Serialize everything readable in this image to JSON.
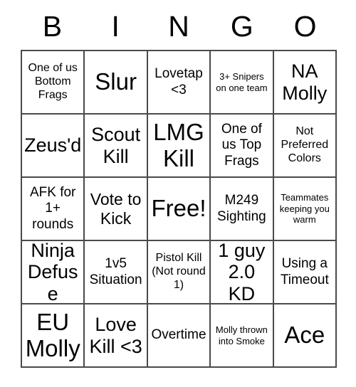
{
  "card": {
    "title": "BINGO",
    "header_letters": [
      "B",
      "I",
      "N",
      "G",
      "O"
    ],
    "grid_size": 5,
    "colors": {
      "background": "#ffffff",
      "grid_line": "#4a4a4a",
      "text": "#000000"
    },
    "cells": [
      {
        "text": "One of us Bottom Frags",
        "size": "sm"
      },
      {
        "text": "Slur",
        "size": "xxl"
      },
      {
        "text": "Lovetap <3",
        "size": "md"
      },
      {
        "text": "3+ Snipers on one team",
        "size": "xs"
      },
      {
        "text": "NA Molly",
        "size": "xl"
      },
      {
        "text": "Zeus'd",
        "size": "xl"
      },
      {
        "text": "Scout Kill",
        "size": "xl"
      },
      {
        "text": "LMG Kill",
        "size": "xxl"
      },
      {
        "text": "One of us Top Frags",
        "size": "md"
      },
      {
        "text": "Not Preferred Colors",
        "size": "sm"
      },
      {
        "text": "AFK for 1+ rounds",
        "size": "md"
      },
      {
        "text": "Vote to Kick",
        "size": "lg"
      },
      {
        "text": "Free!",
        "size": "xxl"
      },
      {
        "text": "M249 Sighting",
        "size": "md"
      },
      {
        "text": "Teammates keeping you warm",
        "size": "xs"
      },
      {
        "text": "Ninja Defuse",
        "size": "xl"
      },
      {
        "text": "1v5 Situation",
        "size": "md"
      },
      {
        "text": "Pistol Kill (Not round 1)",
        "size": "sm"
      },
      {
        "text": "1 guy 2.0 KD",
        "size": "xl"
      },
      {
        "text": "Using a Timeout",
        "size": "md"
      },
      {
        "text": "EU Molly",
        "size": "xxl"
      },
      {
        "text": "Love Kill <3",
        "size": "xl"
      },
      {
        "text": "Overtime",
        "size": "md"
      },
      {
        "text": "Molly thrown into Smoke",
        "size": "xs"
      },
      {
        "text": "Ace",
        "size": "xxl"
      }
    ]
  }
}
